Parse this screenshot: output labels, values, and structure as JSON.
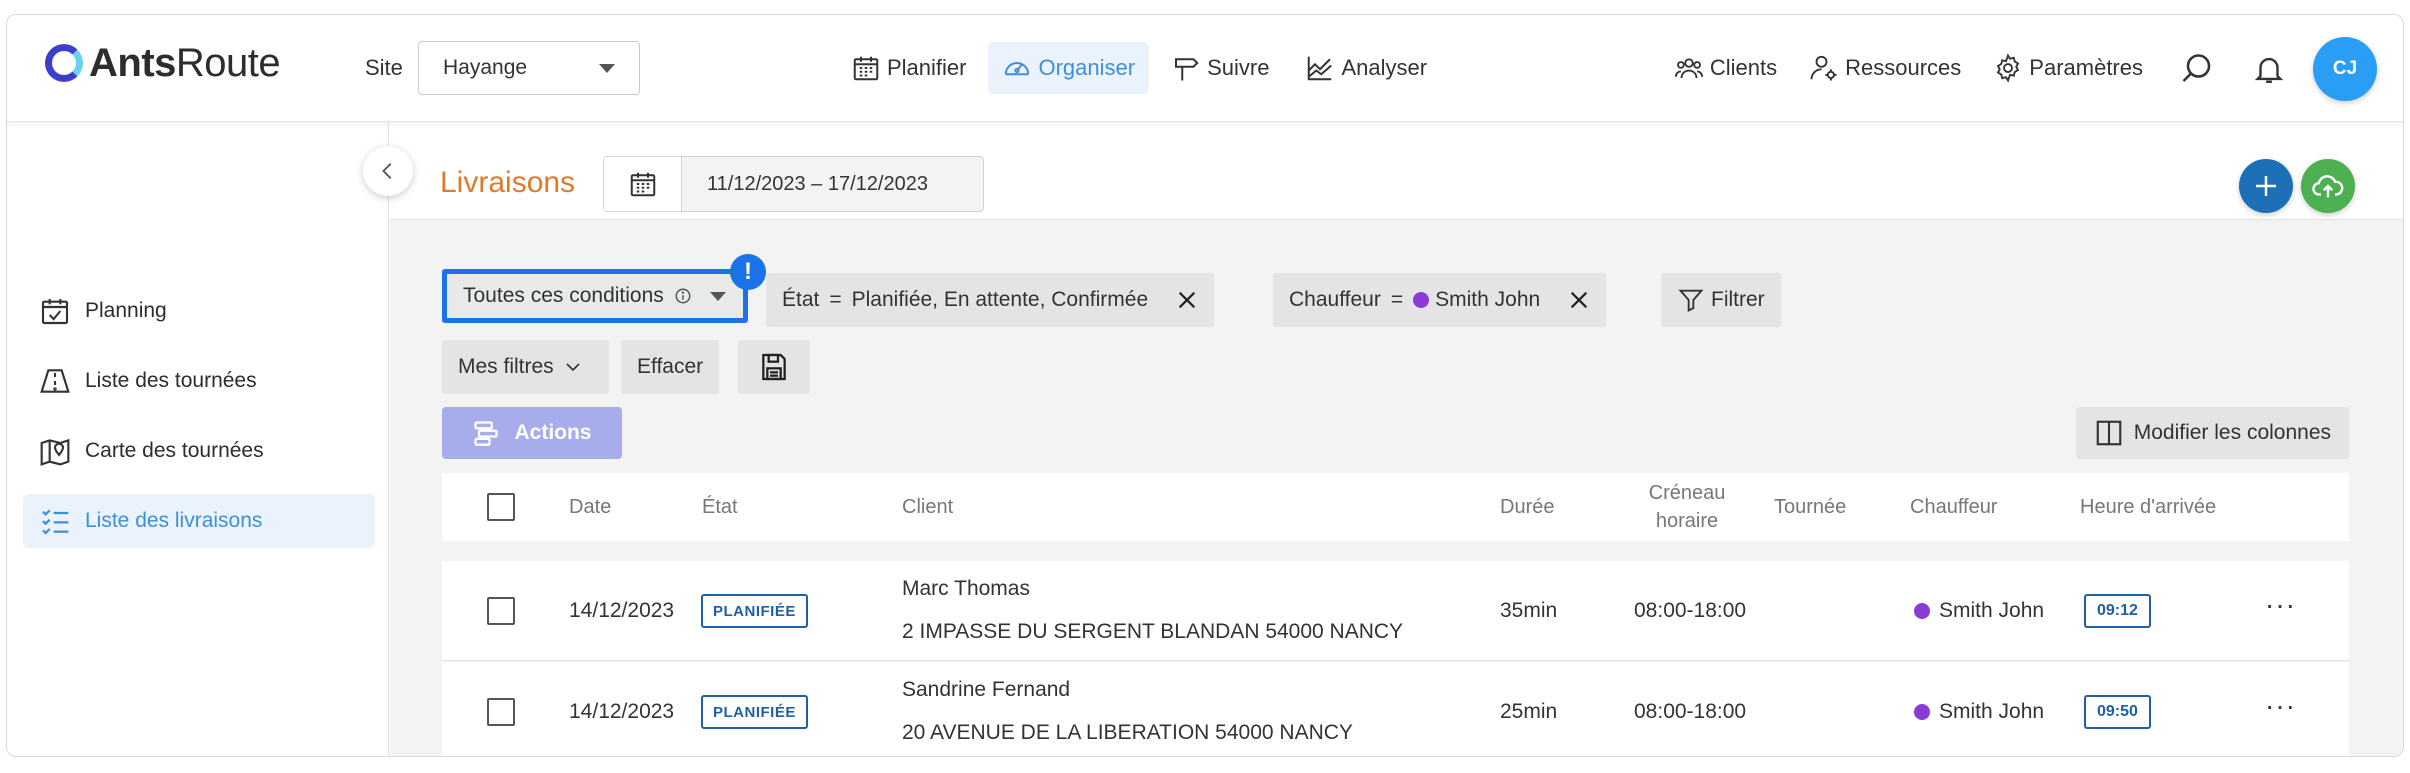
{
  "header": {
    "logo_bold": "Ants",
    "logo_light": "Route",
    "site_label": "Site",
    "site_value": "Hayange",
    "nav": [
      {
        "label": "Planifier",
        "icon": "calendar-icon",
        "active": false
      },
      {
        "label": "Organiser",
        "icon": "gauge-icon",
        "active": true
      },
      {
        "label": "Suivre",
        "icon": "signpost-icon",
        "active": false
      },
      {
        "label": "Analyser",
        "icon": "chart-icon",
        "active": false
      }
    ],
    "right_nav": [
      {
        "label": "Clients",
        "icon": "users-icon"
      },
      {
        "label": "Ressources",
        "icon": "user-gear-icon"
      },
      {
        "label": "Paramètres",
        "icon": "gear-icon"
      }
    ],
    "avatar_initials": "CJ"
  },
  "sidebar": {
    "items": [
      {
        "label": "Planning",
        "icon": "calendar-check-icon",
        "active": false
      },
      {
        "label": "Liste des tournées",
        "icon": "road-icon",
        "active": false
      },
      {
        "label": "Carte des tournées",
        "icon": "map-pin-icon",
        "active": false
      },
      {
        "label": "Liste des livraisons",
        "icon": "checklist-icon",
        "active": true
      }
    ]
  },
  "main": {
    "title": "Livraisons",
    "date_range": "11/12/2023 – 17/12/2023",
    "colors": {
      "accent": "#e07a2a",
      "primary": "#1d6fb8",
      "upload": "#4caf50"
    }
  },
  "filters": {
    "conditions_label": "Toutes ces conditions",
    "warning": "!",
    "etat_field": "État",
    "etat_op": "=",
    "etat_value": "Planifiée, En attente, Confirmée",
    "chauffeur_field": "Chauffeur",
    "chauffeur_op": "=",
    "chauffeur_value": "Smith John",
    "filter_button": "Filtrer",
    "my_filters": "Mes filtres",
    "clear": "Effacer"
  },
  "toolbar": {
    "actions": "Actions",
    "modify_columns": "Modifier les colonnes"
  },
  "table": {
    "headers": {
      "date": "Date",
      "etat": "État",
      "client": "Client",
      "duree": "Durée",
      "creneau_1": "Créneau",
      "creneau_2": "horaire",
      "tournee": "Tournée",
      "chauffeur": "Chauffeur",
      "arrivee": "Heure d'arrivée"
    },
    "rows": [
      {
        "date": "14/12/2023",
        "etat": "PLANIFIÉE",
        "client_name": "Marc Thomas",
        "client_address": "2 IMPASSE DU SERGENT BLANDAN 54000 NANCY",
        "duree": "35min",
        "creneau": "08:00-18:00",
        "tournee": "",
        "chauffeur": "Smith John",
        "arrivee": "09:12"
      },
      {
        "date": "14/12/2023",
        "etat": "PLANIFIÉE",
        "client_name": "Sandrine Fernand",
        "client_address": "20 AVENUE DE LA LIBERATION 54000 NANCY",
        "duree": "25min",
        "creneau": "08:00-18:00",
        "tournee": "",
        "chauffeur": "Smith John",
        "arrivee": "09:50"
      }
    ]
  }
}
